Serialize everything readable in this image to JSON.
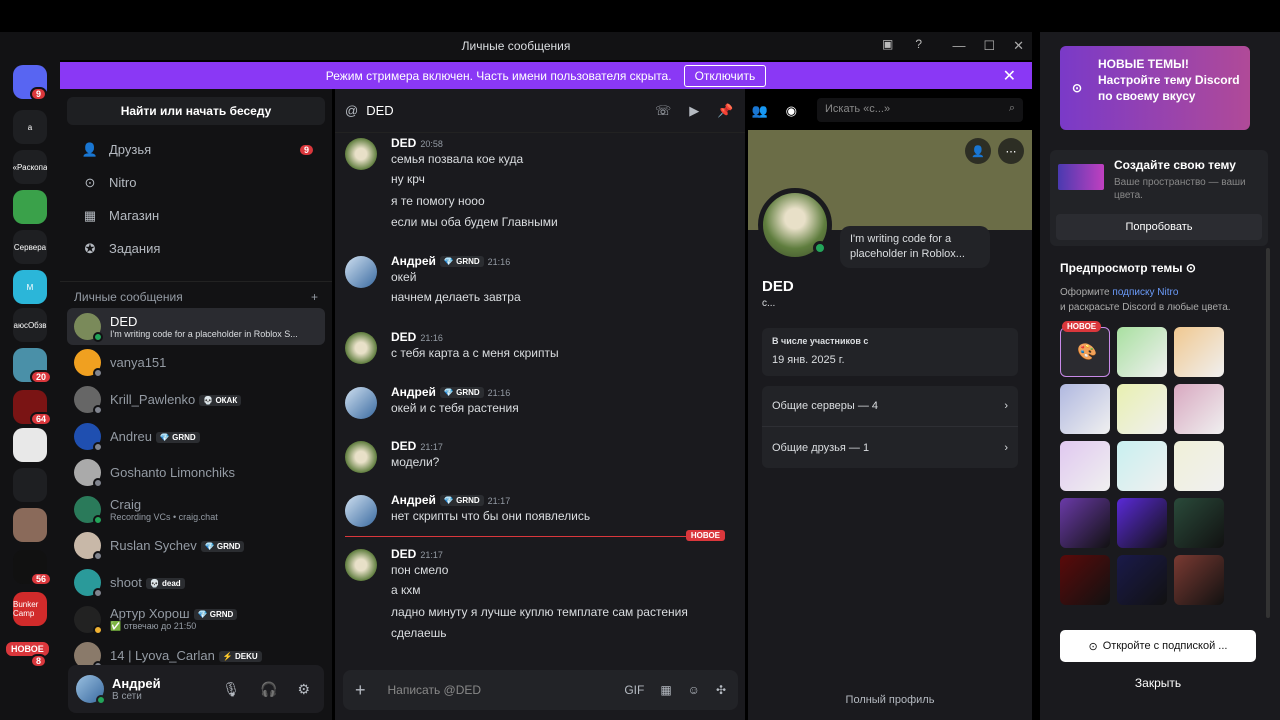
{
  "window": {
    "title": "Личные сообщения"
  },
  "banner": {
    "text": "Режим стримера включен. Часть имени пользователя скрыта.",
    "button": "Отключить"
  },
  "rail": {
    "servers": [
      {
        "label": "",
        "badge": "9",
        "color": "#5865f2"
      },
      {
        "label": "a",
        "badge": "",
        "color": "#1e1f22"
      },
      {
        "label": "«Раскопа",
        "badge": "",
        "color": "#1e1f22"
      },
      {
        "label": "",
        "badge": "",
        "color": "#3aa14a"
      },
      {
        "label": "Сервера",
        "badge": "",
        "color": "#1e1f22"
      },
      {
        "label": "M",
        "badge": "",
        "color": "#2bb6d9"
      },
      {
        "label": "аюсОбзв",
        "badge": "",
        "color": "#1e1f22"
      },
      {
        "label": "",
        "badge": "20",
        "color": "#4a90a8"
      },
      {
        "label": "",
        "badge": "64",
        "color": "#7a1414"
      },
      {
        "label": "",
        "badge": "",
        "color": "#e8e8e8"
      },
      {
        "label": "",
        "badge": "",
        "color": "#1e1f22"
      },
      {
        "label": "",
        "badge": "",
        "color": "#8a6a5a"
      },
      {
        "label": "",
        "badge": "56",
        "color": "#111"
      },
      {
        "label": "Bunker Camp",
        "badge": "",
        "color": "#d12b2b"
      }
    ],
    "new_label": "НОВОЕ",
    "new_badge": "8"
  },
  "sidebar": {
    "search": "Найти или начать беседу",
    "nav": [
      {
        "label": "Друзья",
        "icon": "friends-icon",
        "badge": "9"
      },
      {
        "label": "Nitro",
        "icon": "nitro-icon",
        "badge": ""
      },
      {
        "label": "Магазин",
        "icon": "shop-icon",
        "badge": ""
      },
      {
        "label": "Задания",
        "icon": "quests-icon",
        "badge": ""
      }
    ],
    "dm_header": "Личные сообщения",
    "dms": [
      {
        "name": "DED",
        "sub": "I'm writing code for a placeholder in Roblox S...",
        "tag": "",
        "status": "#23a55a",
        "color": "#7a8a5a"
      },
      {
        "name": "vanya151",
        "sub": "",
        "tag": "",
        "status": "#80848e",
        "color": "#f0a020"
      },
      {
        "name": "Krill_Pawlenko",
        "sub": "",
        "tag": "💀 ОКАК",
        "status": "#80848e",
        "color": "#666"
      },
      {
        "name": "Andreu",
        "sub": "",
        "tag": "💎 GRND",
        "status": "#80848e",
        "color": "#1f4fb0"
      },
      {
        "name": "Goshanto Limonchiks",
        "sub": "",
        "tag": "",
        "status": "#80848e",
        "color": "#aaa"
      },
      {
        "name": "Craig",
        "sub": "Recording VCs • craig.chat",
        "tag": "",
        "status": "#23a55a",
        "color": "#2a7a5a"
      },
      {
        "name": "Ruslan Sychev",
        "sub": "",
        "tag": "💎 GRND",
        "status": "#80848e",
        "color": "#c8b8a8"
      },
      {
        "name": "shoot",
        "sub": "",
        "tag": "💀 dead",
        "status": "#80848e",
        "color": "#2a9a9a"
      },
      {
        "name": "Артур Хорош",
        "sub": "✅ отвечаю до 21:50",
        "tag": "💎 GRND",
        "status": "#f0b232",
        "color": "#222"
      },
      {
        "name": "14 | Lyova_Carlan",
        "sub": "",
        "tag": "⚡ DEKU",
        "status": "#80848e",
        "color": "#8a7a6a"
      }
    ]
  },
  "user": {
    "name": "Андрей",
    "status": "В сети"
  },
  "chat": {
    "recipient": "DED",
    "search_placeholder": "Искать «с...»",
    "composer_placeholder": "Написать @DED",
    "new_label": "НОВОЕ",
    "messages": [
      {
        "author": "DED",
        "time": "20:58",
        "tag": "",
        "lines": [
          "семья позвала кое куда",
          "ну крч",
          "я те помогу нооо",
          "если мы оба будем Главными"
        ]
      },
      {
        "author": "Андрей",
        "time": "21:16",
        "tag": "💎 GRND",
        "lines": [
          "окей",
          "начнем делаеть завтра"
        ]
      },
      {
        "author": "DED",
        "time": "21:16",
        "tag": "",
        "lines": [
          "с тебя карта а с меня скрипты"
        ]
      },
      {
        "author": "Андрей",
        "time": "21:16",
        "tag": "💎 GRND",
        "lines": [
          "окей и с тебя растения"
        ]
      },
      {
        "author": "DED",
        "time": "21:17",
        "tag": "",
        "lines": [
          "модели?"
        ]
      },
      {
        "author": "Андрей",
        "time": "21:17",
        "tag": "💎 GRND",
        "lines": [
          "нет скрипты что бы они появлелись"
        ]
      },
      {
        "author": "DED",
        "time": "21:17",
        "tag": "",
        "lines": [
          "пон смело",
          "а кхм",
          "ладно минуту я лучше куплю темплате сам растения",
          "сделаешь"
        ]
      }
    ]
  },
  "profile": {
    "name": "DED",
    "subtitle": "с...",
    "custom_status": "I'm writing code for a placeholder in Roblox...",
    "member_since_label": "В числе участников с",
    "member_since": "19 янв. 2025 г.",
    "mutual_servers": "Общие серверы — 4",
    "mutual_friends": "Общие друзья — 1",
    "full_profile": "Полный профиль"
  },
  "nitro_panel": {
    "promo_title": "НОВЫЕ ТЕМЫ!",
    "promo_text": "Настройте тему Discord по своему вкусу",
    "create_title": "Создайте свою тему",
    "create_text": "Ваше пространство — ваши цвета.",
    "try_button": "Попробовать",
    "preview_title": "Предпросмотр темы",
    "preview_text_pre": "Оформите ",
    "preview_link": "подписку Nitro",
    "preview_text_post": "и раскрасьте Discord в любые цвета.",
    "new_badge": "НОВОЕ",
    "unlock_button": "Откройте с подпиской ...",
    "close_button": "Закрыть",
    "swatches": [
      "#2b2b30",
      "#a8e0a0",
      "#f0c890",
      "#b0b8e0",
      "#e8f0b0",
      "#d8a8c0",
      "#e0c8f0",
      "#c8f0f0",
      "#f0f0d8",
      "#6a3aa8",
      "#5a2ad8",
      "#2a4a3a",
      "#5a0a0a",
      "#1a1a4a",
      "#7a3a32"
    ]
  }
}
